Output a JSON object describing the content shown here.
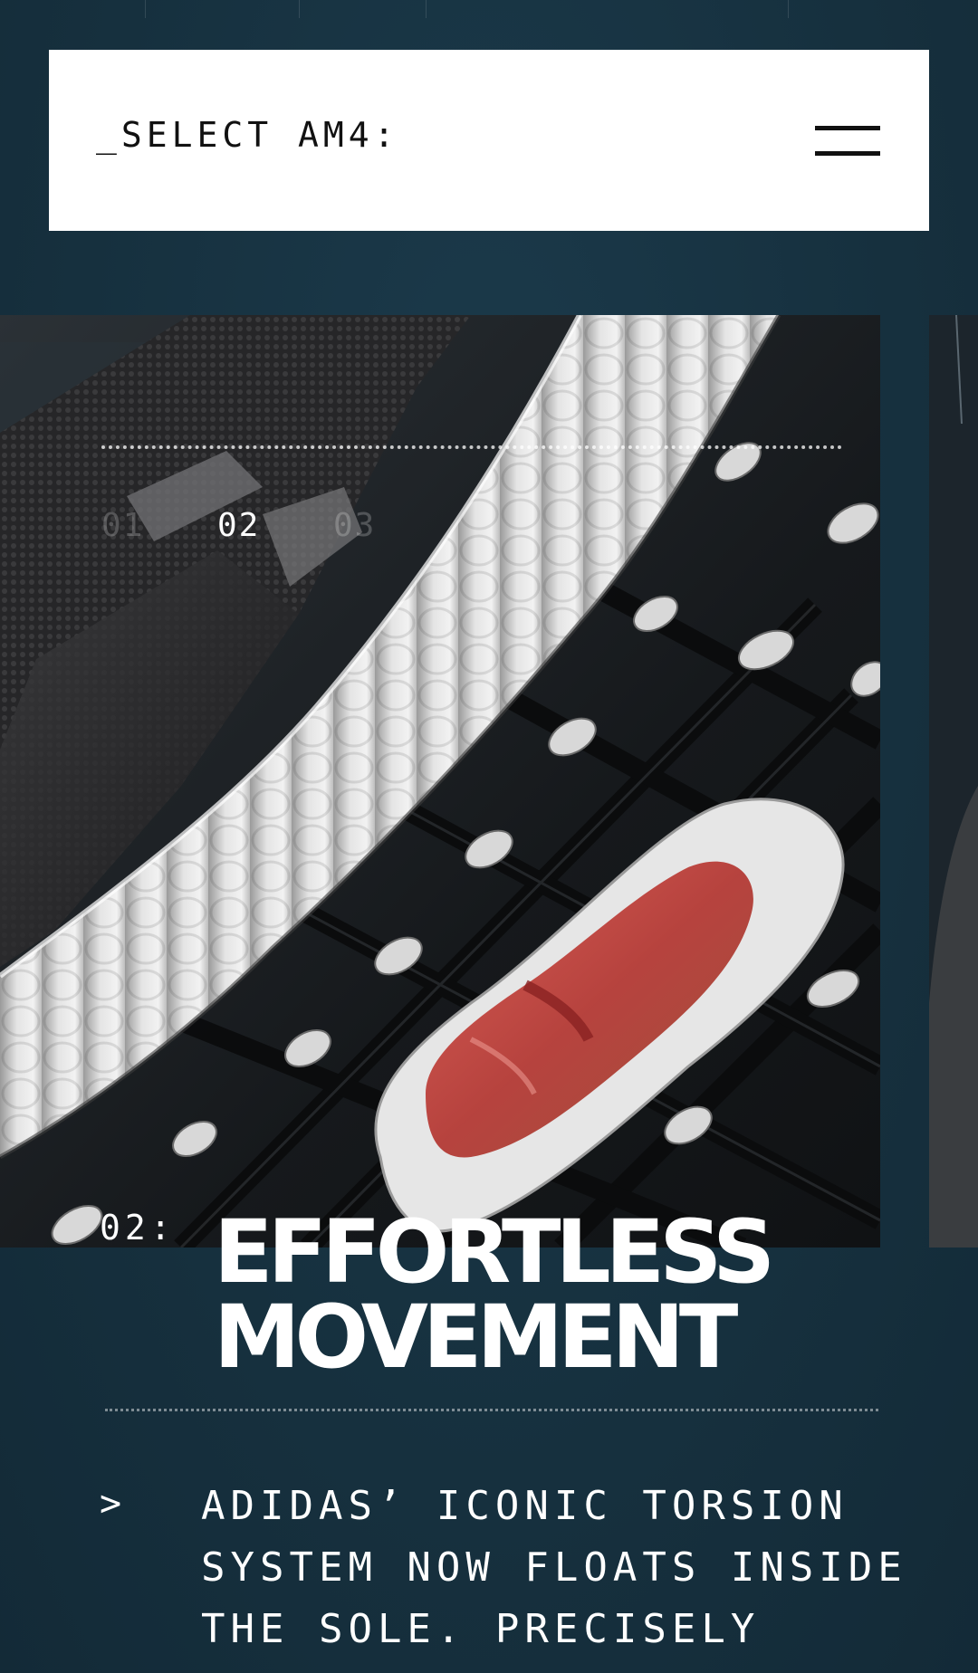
{
  "header": {
    "title": "_SELECT AM4:",
    "menu_icon": "hamburger-menu-icon"
  },
  "slider": {
    "numbers": [
      "01",
      "02",
      "03"
    ],
    "active_index": 1
  },
  "feature": {
    "index": "02:",
    "headline_line1": "EFFORTLESS",
    "headline_line2": "MOVEMENT",
    "bullet": ">",
    "body_line1": "ADIDAS’ ICONIC TORSION",
    "body_line2": "SYSTEM NOW FLOATS INSIDE",
    "body_line3": "THE SOLE. PRECISELY"
  },
  "colors": {
    "background": "#17313f",
    "card": "#ffffff",
    "text_dark": "#111111",
    "text_light": "#ffffff",
    "torsion_accent": "#c8463f"
  }
}
